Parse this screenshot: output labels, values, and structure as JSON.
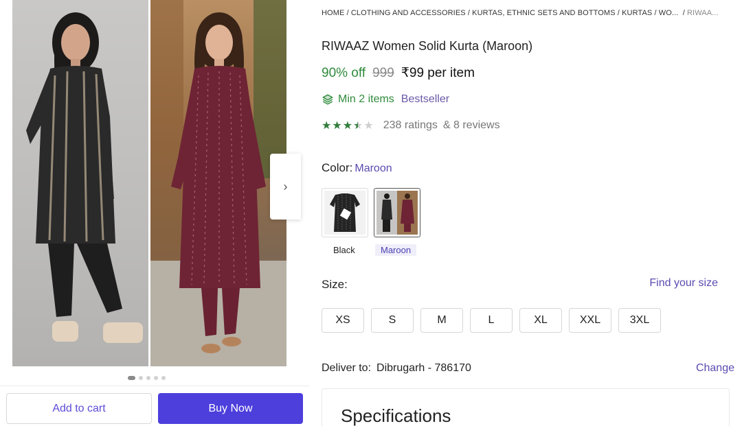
{
  "gallery": {
    "next_arrow": "›",
    "dot_count": 5,
    "active_dot": 0
  },
  "actions": {
    "add_to_cart": "Add to cart",
    "buy_now": "Buy Now"
  },
  "breadcrumb": {
    "items": [
      "HOME",
      "CLOTHING AND ACCESSORIES",
      "KURTAS, ETHNIC SETS AND BOTTOMS",
      "KURTAS",
      "WO..."
    ],
    "separator": "/",
    "last": "RIWAA..."
  },
  "product": {
    "title": "RIWAAZ Women Solid Kurta (Maroon)",
    "discount": "90% off",
    "mrp": "999",
    "price": "₹99 per item",
    "min_items": "Min 2 items",
    "bestseller": "Bestseller",
    "rating_stars": 3.5,
    "ratings": "238 ratings",
    "reviews": "& 8 reviews"
  },
  "color": {
    "label": "Color:",
    "selected": "Maroon",
    "options": [
      "Black",
      "Maroon"
    ]
  },
  "size": {
    "label": "Size:",
    "find_link": "Find your size",
    "options": [
      "XS",
      "S",
      "M",
      "L",
      "XL",
      "XXL",
      "3XL"
    ]
  },
  "delivery": {
    "label": "Deliver to:",
    "location": "Dibrugarh - 786170",
    "change": "Change"
  },
  "specifications": {
    "title": "Specifications"
  },
  "colors": {
    "accent": "#4d3fdc",
    "link": "#5a4bb0",
    "discount_green": "#2f8a3b",
    "star_green": "#2f7d39",
    "maroon": "#7a2a3e"
  }
}
